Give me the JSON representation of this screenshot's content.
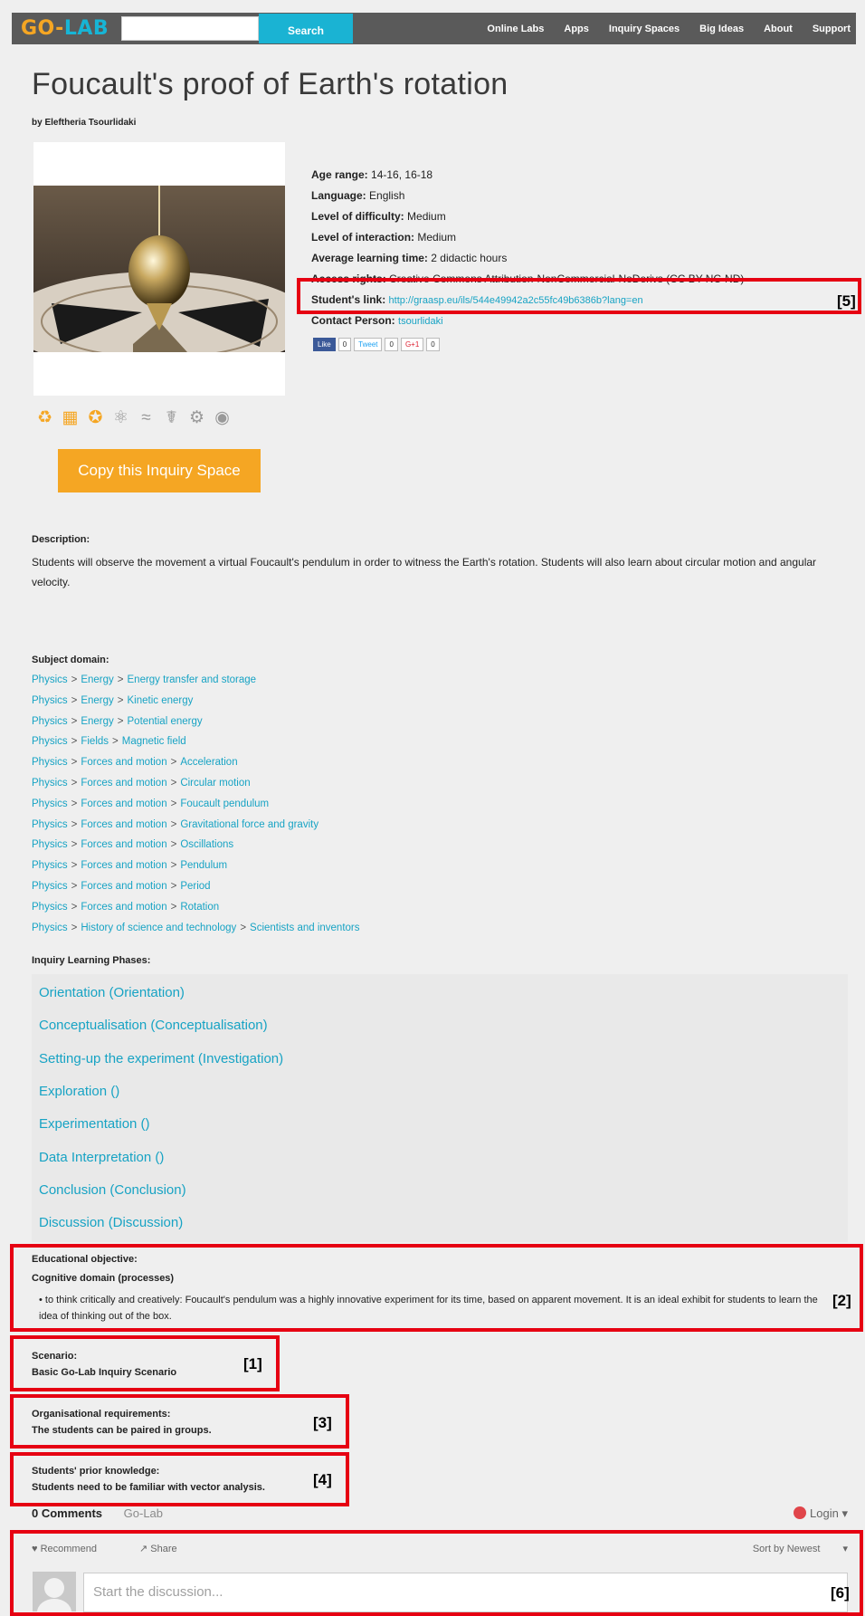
{
  "nav": {
    "logo_go": "GO-",
    "logo_lab": "LAB",
    "search_label": "Search",
    "links": [
      "Online Labs",
      "Apps",
      "Inquiry Spaces",
      "Big Ideas",
      "About",
      "Support"
    ]
  },
  "page": {
    "title": "Foucault's proof of Earth's rotation",
    "byline": "by Eleftheria Tsourlidaki",
    "copy_button": "Copy this Inquiry Space"
  },
  "meta": {
    "age_label": "Age range:",
    "age_value": "14-16, 16-18",
    "lang_label": "Language:",
    "lang_value": "English",
    "difficulty_label": "Level of difficulty:",
    "difficulty_value": "Medium",
    "interaction_label": "Level of interaction:",
    "interaction_value": "Medium",
    "time_label": "Average learning time:",
    "time_value": "2 didactic hours",
    "license_label": "Access rights:",
    "license_value": "Creative Commons Attribution-NonCommercial-NoDerivs (CC BY-NC-ND)",
    "student_link_label": "Student's link:",
    "student_link_value": "http://graasp.eu/ils/544e49942a2c55fc49b6386b?lang=en",
    "contact_label": "Contact Person:",
    "contact_value": "tsourlidaki"
  },
  "social": {
    "like": "Like",
    "like_count": "0",
    "tweet": "Tweet",
    "tweet_count": "0",
    "gplus": "G+1",
    "gplus_count": "0"
  },
  "annotations": {
    "tag1": "[1]",
    "tag2": "[2]",
    "tag3": "[3]",
    "tag4": "[4]",
    "tag5": "[5]",
    "tag6": "[6]"
  },
  "description": {
    "label": "Description:",
    "text": "Students will observe the movement a virtual Foucault's pendulum in order to witness the Earth's rotation. Students will also learn about circular motion and angular velocity."
  },
  "subject": {
    "label": "Subject domain:",
    "rows": [
      [
        "Physics",
        "Energy",
        "Energy transfer and storage"
      ],
      [
        "Physics",
        "Energy",
        "Kinetic energy"
      ],
      [
        "Physics",
        "Energy",
        "Potential energy"
      ],
      [
        "Physics",
        "Fields",
        "Magnetic field"
      ],
      [
        "Physics",
        "Forces and motion",
        "Acceleration"
      ],
      [
        "Physics",
        "Forces and motion",
        "Circular motion"
      ],
      [
        "Physics",
        "Forces and motion",
        "Foucault pendulum"
      ],
      [
        "Physics",
        "Forces and motion",
        "Gravitational force and gravity"
      ],
      [
        "Physics",
        "Forces and motion",
        "Oscillations"
      ],
      [
        "Physics",
        "Forces and motion",
        "Pendulum"
      ],
      [
        "Physics",
        "Forces and motion",
        "Period"
      ],
      [
        "Physics",
        "Forces and motion",
        "Rotation"
      ],
      [
        "Physics",
        "History of science and technology",
        "Scientists and inventors"
      ]
    ]
  },
  "phases": {
    "label": "Inquiry Learning Phases:",
    "items": [
      "Orientation (Orientation)",
      "Conceptualisation (Conceptualisation)",
      "Setting-up the experiment (Investigation)",
      "Exploration ()",
      "Experimentation ()",
      "Data Interpretation ()",
      "Conclusion (Conclusion)",
      "Discussion (Discussion)"
    ]
  },
  "objective": {
    "label": "Educational objective:",
    "sublabel": "Cognitive domain (processes)",
    "bullet": "to think critically and creatively:  Foucault's pendulum was a highly innovative experiment for its time, based on apparent movement. It is an ideal exhibit for students to learn the idea of thinking out of the box."
  },
  "scenario": {
    "label": "Scenario:",
    "value": "Basic Go-Lab Inquiry Scenario"
  },
  "org": {
    "label": "Organisational requirements:",
    "value": "The students can be paired in groups."
  },
  "prior": {
    "label": "Students' prior knowledge:",
    "value": "Students need to be familiar with vector analysis."
  },
  "comments": {
    "count": "0 Comments",
    "site": "Go-Lab",
    "login": "Login",
    "recommend": "Recommend",
    "share": "Share",
    "sort": "Sort by Newest",
    "placeholder": "Start the discussion..."
  }
}
